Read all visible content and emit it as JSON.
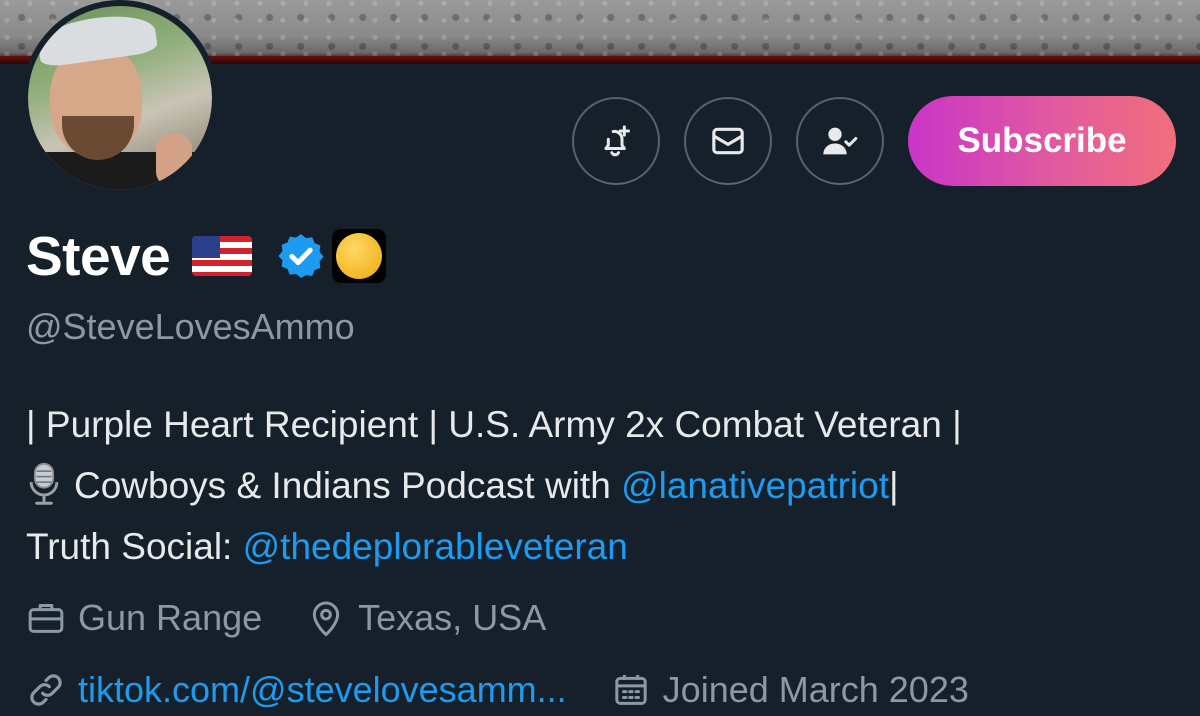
{
  "profile": {
    "display_name": "Steve",
    "handle": "@SteveLovesAmmo",
    "bio": {
      "line1": "| Purple Heart Recipient | U.S. Army 2x Combat Veteran |",
      "line2_text": "Cowboys & Indians Podcast with ",
      "line2_link": "@lanativepatriot",
      "line2_tail": "|",
      "line3_text": "Truth Social: ",
      "line3_link": "@thedeplorableveteran"
    },
    "meta": {
      "profession": "Gun Range",
      "location": "Texas, USA",
      "website": "tiktok.com/@stevelovesamm...",
      "joined": "Joined March 2023"
    }
  },
  "actions": {
    "subscribe_label": "Subscribe"
  },
  "icons": {
    "notify": "bell-plus-icon",
    "message": "envelope-icon",
    "following": "person-check-icon",
    "verified": "verified-badge-icon",
    "flag": "us-flag-icon",
    "badge": "gold-affiliate-badge",
    "mic": "microphone-icon",
    "profession": "briefcase-icon",
    "location": "location-pin-icon",
    "link": "link-icon",
    "calendar": "calendar-icon"
  },
  "colors": {
    "background": "#15202b",
    "link": "#1d9bf0",
    "muted": "#8b98a5",
    "verified": "#1d9bf0",
    "subscribe_gradient_start": "#c935c7",
    "subscribe_gradient_end": "#f06f7a"
  }
}
